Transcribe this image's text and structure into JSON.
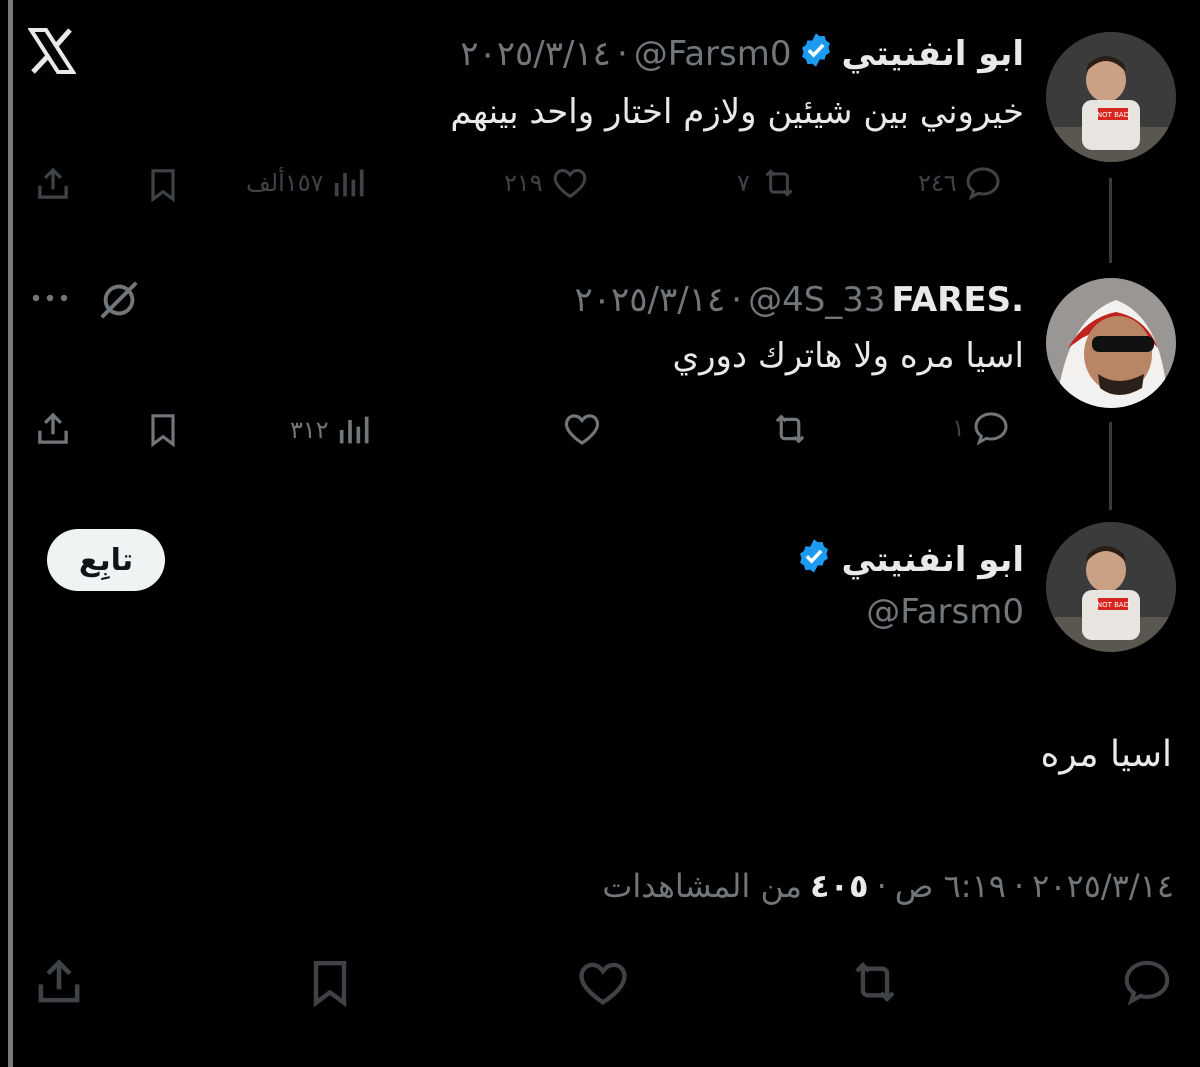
{
  "app": {
    "logo": "X"
  },
  "tweet1": {
    "name": "ابو انفنيتي",
    "handle": "@Farsm0",
    "date": "٢٠٢٥/٣/١٤",
    "text": "خيروني بين شيئين ولازم اختار واحد بينهم",
    "replies": "٢٤٦",
    "retweets": "٧",
    "likes": "٢١٩",
    "views": "١٥٧ألف"
  },
  "tweet2": {
    "name": "FARES.",
    "handle": "@4S_33",
    "date": "٢٠٢٥/٣/١٤",
    "text": "اسيا مره ولا هاترك دوري",
    "replies": "١",
    "views": "٣١٢"
  },
  "main_tweet": {
    "name": "ابو انفنيتي",
    "handle": "@Farsm0",
    "follow_label": "تابِع",
    "text": "اسيا مره",
    "date": "٢٠٢٥/٣/١٤",
    "time": "٦:١٩ ص",
    "views_count": "٤٠٥",
    "views_label": "من المشاهدات",
    "separator": "·"
  },
  "colors": {
    "background": "#000000",
    "verified": "#1d9bf0",
    "muted": "#71767b"
  },
  "icons": [
    "x-logo-icon",
    "verified-icon",
    "reply-icon",
    "retweet-icon",
    "like-icon",
    "views-icon",
    "bookmark-icon",
    "share-icon",
    "grok-icon",
    "more-icon"
  ]
}
